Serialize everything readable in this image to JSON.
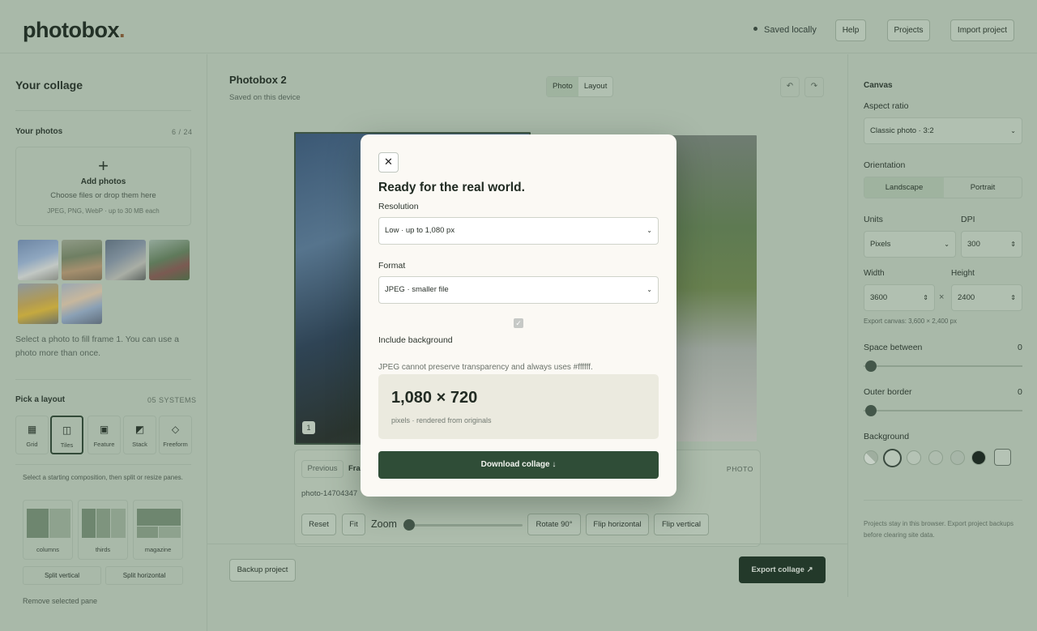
{
  "header": {
    "logo": "photobox",
    "logo_dot": ".",
    "saved_status": "Saved locally",
    "help_label": "Help",
    "projects_label": "Projects",
    "import_label": "Import project"
  },
  "left": {
    "title": "Your collage",
    "photos_label": "Your photos",
    "photos_count": "6 / 24",
    "add_plus": "+",
    "add_title": "Add photos",
    "add_sub": "Choose files or drop them here",
    "add_formats": "JPEG, PNG, WebP · up to 30 MB each",
    "hint": "Select a photo to fill frame 1. You can use a photo more than once.",
    "layout_label": "Pick a layout",
    "layout_count": "05 SYSTEMS",
    "layouts": [
      {
        "label": "Grid",
        "icon": "▦"
      },
      {
        "label": "Tiles",
        "icon": "◫"
      },
      {
        "label": "Feature",
        "icon": "▣"
      },
      {
        "label": "Stack",
        "icon": "◩"
      },
      {
        "label": "Freeform",
        "icon": "◇"
      }
    ],
    "composition_hint": "Select a starting composition, then split or resize panes.",
    "compositions": [
      "columns",
      "thirds",
      "magazine"
    ],
    "split_vertical": "Split vertical",
    "split_horizontal": "Split horizontal",
    "remove_pane": "Remove selected pane"
  },
  "center": {
    "project_title": "Photobox 2",
    "project_sub": "Saved on this device",
    "mode_photo": "Photo",
    "mode_layout": "Layout",
    "undo_icon": "↶",
    "redo_icon": "↷",
    "frame_number": "1",
    "tab_previous": "Previous",
    "tab_frame": "Fra",
    "panel_tag": "PHOTO",
    "filename": "photo-14704347",
    "reset_label": "Reset",
    "fit_label": "Fit",
    "zoom_label": "Zoom",
    "rotate_label": "Rotate 90°",
    "flip_h_label": "Flip horizontal",
    "flip_v_label": "Flip vertical",
    "backup_label": "Backup project",
    "export_label": "Export collage ↗"
  },
  "right": {
    "canvas_label": "Canvas",
    "aspect_label": "Aspect ratio",
    "aspect_value": "Classic photo · 3:2",
    "orientation_label": "Orientation",
    "landscape": "Landscape",
    "portrait": "Portrait",
    "units_label": "Units",
    "units_value": "Pixels",
    "dpi_label": "DPI",
    "dpi_value": "300",
    "width_label": "Width",
    "width_value": "3600",
    "height_label": "Height",
    "height_value": "2400",
    "times": "×",
    "export_canvas": "Export canvas: 3,600 × 2,400 px",
    "space_label": "Space between",
    "space_value": "0",
    "border_label": "Outer border",
    "border_value": "0",
    "background_label": "Background",
    "footer_note": "Projects stay in this browser. Export project backups before clearing site data."
  },
  "modal": {
    "close_icon": "✕",
    "title": "Ready for the real world.",
    "resolution_label": "Resolution",
    "resolution_value": "Low · up to 1,080 px",
    "format_label": "Format",
    "format_value": "JPEG · smaller file",
    "checkbox_mark": "✓",
    "include_bg_label": "Include background",
    "note": "JPEG cannot preserve transparency and always uses #ffffff.",
    "size_value": "1,080 × 720",
    "size_sub": "pixels · rendered from originals",
    "download_label": "Download collage ↓"
  },
  "colors": {
    "accent_dark": "#2f4d37",
    "modal_bg": "#fbf9f4",
    "backdrop": "#a9b9a9"
  }
}
